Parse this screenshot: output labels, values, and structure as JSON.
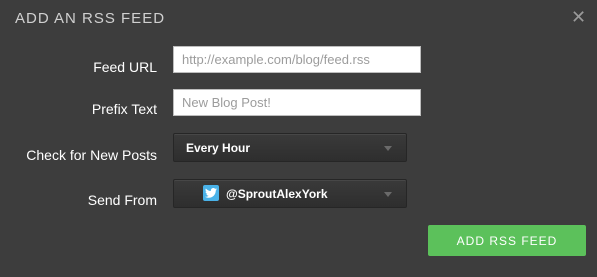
{
  "modal": {
    "title": "ADD AN RSS FEED",
    "close_icon": "close-icon"
  },
  "form": {
    "feed_url": {
      "label": "Feed URL",
      "placeholder": "http://example.com/blog/feed.rss",
      "value": ""
    },
    "prefix_text": {
      "label": "Prefix Text",
      "placeholder": "New Blog Post!",
      "value": ""
    },
    "check_frequency": {
      "label": "Check for New Posts",
      "selected": "Every Hour"
    },
    "send_from": {
      "label": "Send From",
      "selected": "@SproutAlexYork",
      "icon": "twitter-icon"
    }
  },
  "actions": {
    "submit_label": "ADD RSS FEED"
  },
  "colors": {
    "background": "#3d3d3d",
    "accent_green": "#5cc15b",
    "twitter_blue": "#4ab2e8"
  }
}
